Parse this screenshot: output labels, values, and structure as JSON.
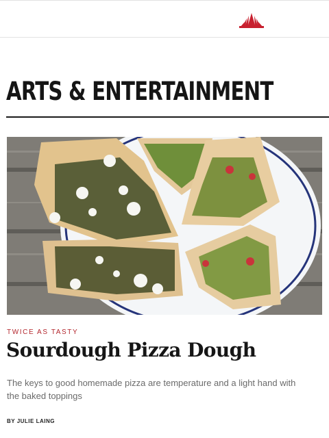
{
  "header": {
    "logo_icon": "sunburst-logo-icon",
    "logo_color": "#c8202f"
  },
  "section": {
    "title": "ARTS & ENTERTAINMENT"
  },
  "article": {
    "kicker": "TWICE AS TASTY",
    "headline": "Sourdough Pizza Dough",
    "dek": "The keys to good homemade pizza are temperature and a light hand with the baked toppings",
    "byline": "BY JULIE LAING",
    "image_subject": "pizza-slices-photo"
  },
  "colors": {
    "accent": "#b3272e",
    "rule": "#1a1a1a",
    "text": "#161616",
    "muted": "#6a6a6a"
  }
}
